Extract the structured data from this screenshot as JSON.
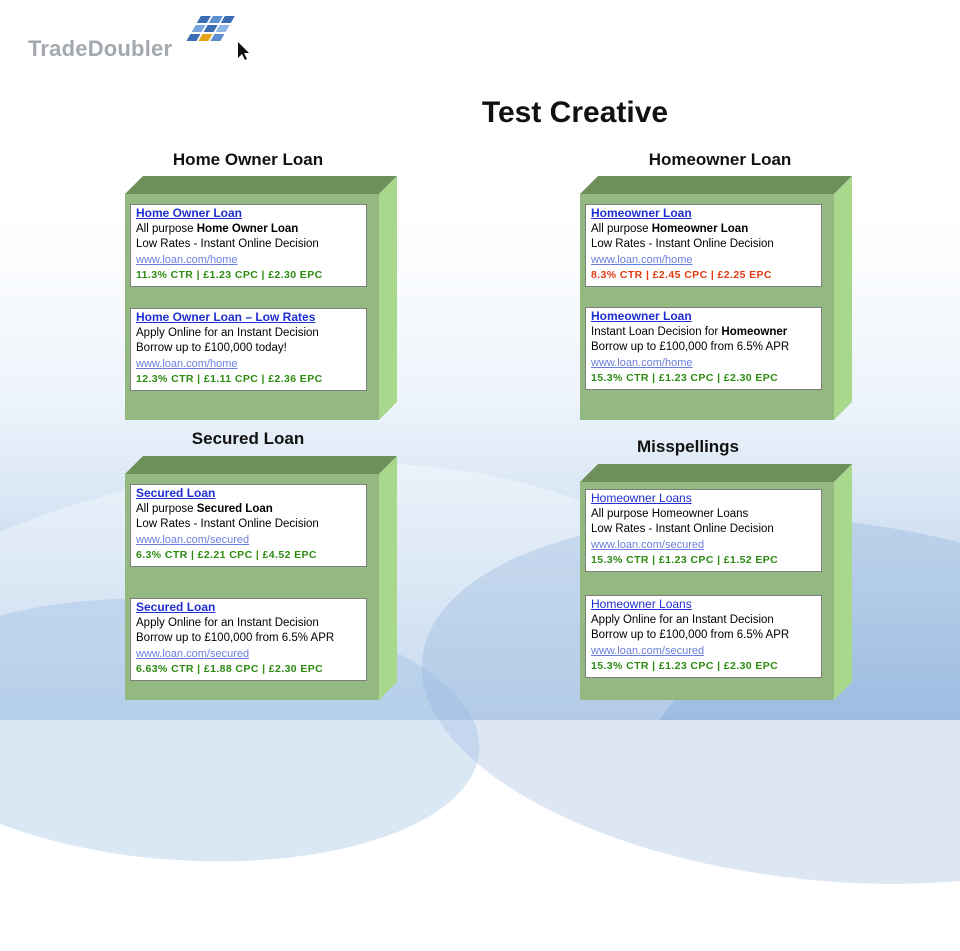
{
  "brand": {
    "name": "TradeDoubler"
  },
  "title": "Test Creative",
  "sections": [
    {
      "id": "home-owner-loan",
      "title": "Home Owner Loan",
      "ads": [
        {
          "headline": "Home Owner Loan",
          "line1_pre": "All purpose ",
          "line1_kw": "Home Owner Loan",
          "line1_post": "",
          "line2": "Low Rates - Instant Online Decision",
          "url": "www.loan.com/home",
          "stats": "11.3% CTR  |  £1.23  CPC  |  £2.30  EPC"
        },
        {
          "headline": "Home Owner Loan – Low Rates",
          "line1_pre": "Apply Online for an Instant Decision",
          "line1_kw": "",
          "line1_post": "",
          "line2": "Borrow up to £100,000 today!",
          "url": "www.loan.com/home",
          "stats": "12.3% CTR  |  £1.11  CPC  |  £2.36  EPC"
        }
      ]
    },
    {
      "id": "homeowner-loan",
      "title": "Homeowner Loan",
      "ads": [
        {
          "headline": "Homeowner Loan",
          "line1_pre": "All purpose ",
          "line1_kw": "Homeowner Loan",
          "line1_post": "",
          "line2": "Low Rates - Instant Online Decision",
          "url": "www.loan.com/home",
          "stats": "8.3% CTR  |  £2.45  CPC  |  £2.25  EPC"
        },
        {
          "headline": "Homeowner Loan",
          "line1_pre": "Instant Loan Decision for ",
          "line1_kw": "Homeowner",
          "line1_post": "",
          "line2": "Borrow up to £100,000  from 6.5% APR",
          "url": "www.loan.com/home",
          "stats": "15.3% CTR  |  £1.23  CPC  |  £2.30  EPC"
        }
      ]
    },
    {
      "id": "secured-loan",
      "title": "Secured Loan",
      "ads": [
        {
          "headline": "Secured Loan",
          "line1_pre": "All purpose ",
          "line1_kw": "Secured Loan",
          "line1_post": "",
          "line2": "Low Rates - Instant Online Decision",
          "url": "www.loan.com/secured",
          "stats": "6.3% CTR  |  £2.21  CPC  |  £4.52  EPC"
        },
        {
          "headline": "Secured Loan",
          "line1_pre": "Apply Online for an Instant Decision",
          "line1_kw": "",
          "line1_post": "",
          "line2": "Borrow up to £100,000  from 6.5% APR",
          "url": "www.loan.com/secured",
          "stats": "6.63% CTR  |  £1.88  CPC  |  £2.30  EPC"
        }
      ]
    },
    {
      "id": "misspellings",
      "title": "Misspellings",
      "ads": [
        {
          "headline": "Homeowner Loans",
          "line1_pre": "All purpose Homeowner Loans",
          "line1_kw": "",
          "line1_post": "",
          "line2": "Low Rates - Instant Online Decision",
          "url": "www.loan.com/secured",
          "stats": "15.3% CTR  |  £1.23  CPC  |  £1.52  EPC"
        },
        {
          "headline": "Homeowner Loans",
          "line1_pre": "Apply Online for an Instant Decision",
          "line1_kw": "",
          "line1_post": "",
          "line2": "Borrow up to £100,000  from 6.5% APR",
          "url": "www.loan.com/secured",
          "stats": "15.3% CTR  |  £1.23  CPC  |  £2.30  EPC"
        }
      ]
    }
  ],
  "colors": {
    "headline": "#1f2fd0",
    "url": "#6a7de0",
    "stats_green": "#2e8b12",
    "stats_red": "#e03b12",
    "box_front": "#93b880",
    "box_top": "#6f8f5a",
    "box_side": "#a8d88c"
  }
}
